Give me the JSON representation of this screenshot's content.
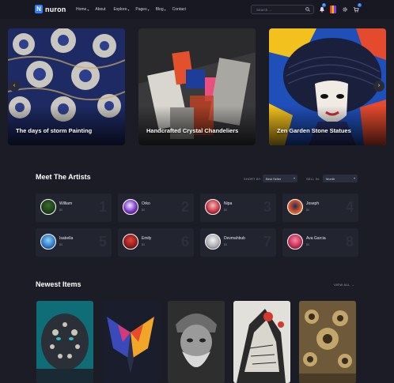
{
  "header": {
    "logo_letter": "N",
    "logo_text": "nuron",
    "nav": [
      {
        "label": "Home",
        "has_dropdown": true
      },
      {
        "label": "About",
        "has_dropdown": false
      },
      {
        "label": "Explore",
        "has_dropdown": true
      },
      {
        "label": "Pages",
        "has_dropdown": true
      },
      {
        "label": "Blog",
        "has_dropdown": true
      },
      {
        "label": "Contact",
        "has_dropdown": false
      }
    ],
    "search_placeholder": "Search ...",
    "notification_count": "6",
    "cart_count": "0",
    "icons": [
      "search-icon",
      "bell-icon",
      "user-avatar",
      "gear-icon",
      "cart-icon"
    ]
  },
  "slider": {
    "slides": [
      {
        "title": "The days of storm Painting"
      },
      {
        "title": "Handcrafted Crystal Chandeliers"
      },
      {
        "title": "Zen Garden Stone Statues"
      }
    ],
    "prev_icon": "arrow-left-icon",
    "next_icon": "arrow-right-icon"
  },
  "artists_section": {
    "title": "Meet The Artists",
    "sort_label": "SHORT BY:",
    "sort_value": "Best Seller",
    "sell_label": "SELL IN:",
    "sell_value": "Month",
    "artists": [
      {
        "name": "William",
        "amount": "$0",
        "rank": "1"
      },
      {
        "name": "Orko",
        "amount": "$0",
        "rank": "2"
      },
      {
        "name": "Nipa",
        "amount": "$0",
        "rank": "3"
      },
      {
        "name": "Joseph",
        "amount": "$0",
        "rank": "4"
      },
      {
        "name": "Isabella",
        "amount": "$0",
        "rank": "5"
      },
      {
        "name": "Emily",
        "amount": "$0",
        "rank": "6"
      },
      {
        "name": "Devmahbub",
        "amount": "$0",
        "rank": "7"
      },
      {
        "name": "Ava Garcia",
        "amount": "$0",
        "rank": "8"
      }
    ]
  },
  "newest_section": {
    "title": "Newest Items",
    "view_all": "VIEW ALL"
  },
  "colors": {
    "background": "#1b1c26",
    "accent": "#2f7cf6",
    "card": "#22242f"
  }
}
